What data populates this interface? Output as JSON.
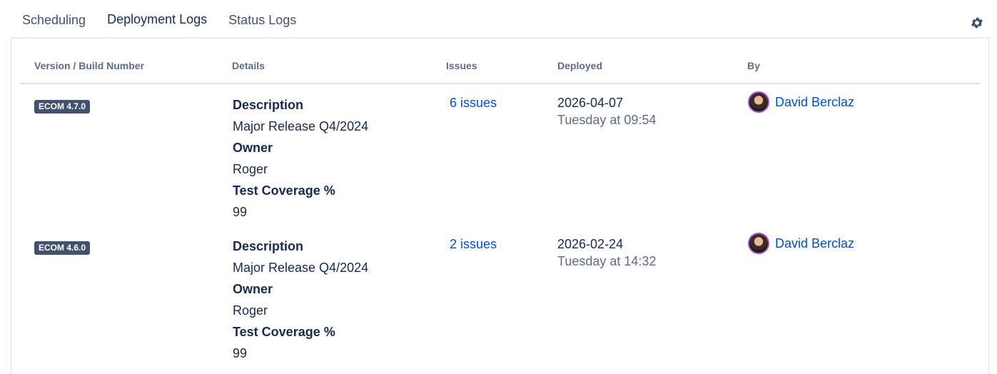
{
  "tabs": [
    {
      "label": "Scheduling",
      "active": false
    },
    {
      "label": "Deployment Logs",
      "active": true
    },
    {
      "label": "Status Logs",
      "active": false
    }
  ],
  "settings_icon": "gear-icon",
  "table": {
    "headers": {
      "version": "Version / Build Number",
      "details": "Details",
      "issues": "Issues",
      "deployed": "Deployed",
      "by": "By"
    },
    "rows": [
      {
        "version": "ECOM 4.7.0",
        "details": [
          {
            "label": "Description",
            "value": "Major Release Q4/2024"
          },
          {
            "label": "Owner",
            "value": "Roger"
          },
          {
            "label": "Test Coverage %",
            "value": "99"
          }
        ],
        "issues": "6 issues",
        "date": "2026-04-07",
        "when": "Tuesday at 09:54",
        "user": "David Berclaz"
      },
      {
        "version": "ECOM 4.6.0",
        "details": [
          {
            "label": "Description",
            "value": "Major Release Q4/2024"
          },
          {
            "label": "Owner",
            "value": "Roger"
          },
          {
            "label": "Test Coverage %",
            "value": "99"
          }
        ],
        "issues": "2 issues",
        "date": "2026-02-24",
        "when": "Tuesday at 14:32",
        "user": "David Berclaz"
      }
    ]
  },
  "colors": {
    "accent": "#0052cc",
    "badge": "#42526e",
    "muted": "#5e6c84"
  }
}
